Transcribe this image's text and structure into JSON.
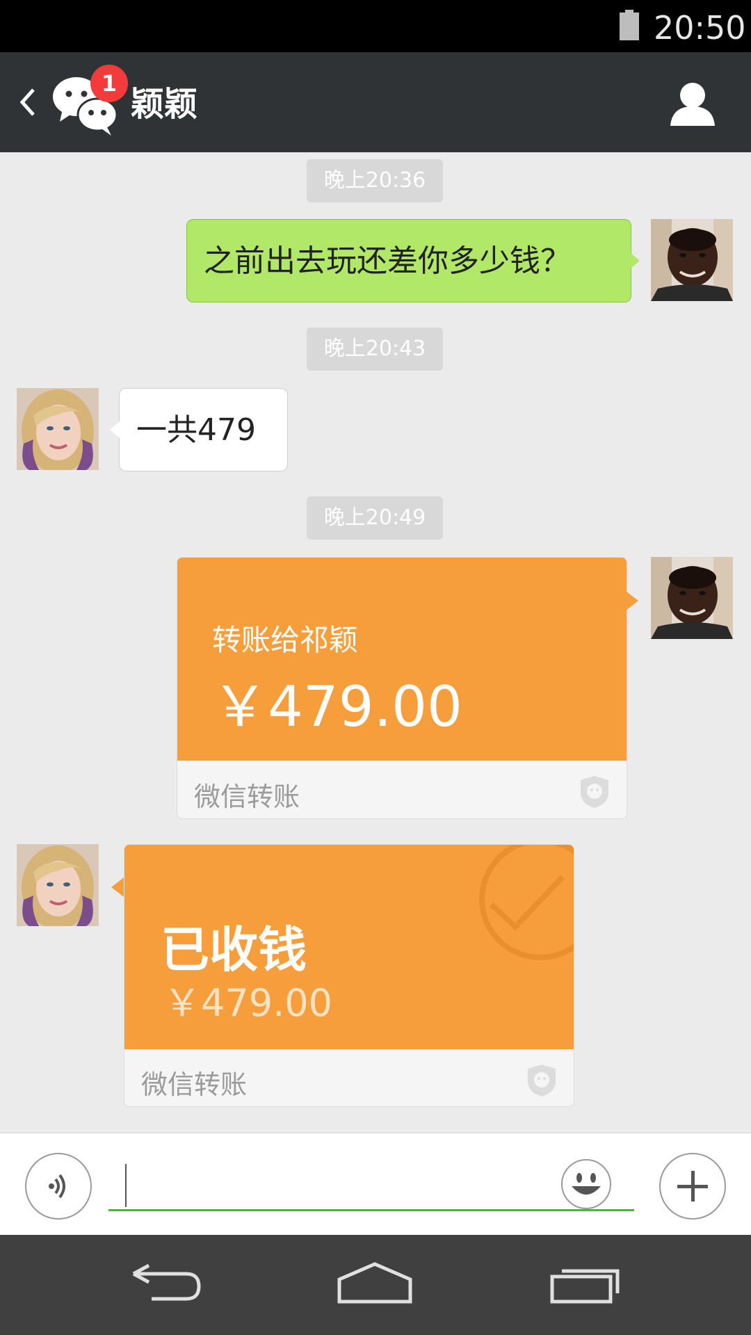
{
  "status_bar": {
    "time": "20:50",
    "battery_icon": "battery-icon"
  },
  "header": {
    "back_icon": "back-chevron-icon",
    "app_icon": "wechat-icon",
    "badge_count": "1",
    "title": "颖颖",
    "profile_icon": "profile-icon"
  },
  "messages": {
    "time1": "晚上20:36",
    "msg1": "之前出去玩还差你多少钱？",
    "time2": "晚上20:43",
    "msg2": "一共479",
    "time3": "晚上20:49",
    "transfer_sent": {
      "title": "转账给祁颖",
      "amount": "￥479.00",
      "footer": "微信转账"
    },
    "transfer_received": {
      "title": "已收钱",
      "amount": "￥479.00",
      "footer": "微信转账"
    }
  },
  "input_bar": {
    "voice_icon": "voice-icon",
    "emoji_icon": "emoji-icon",
    "plus_icon": "plus-icon",
    "input_value": ""
  },
  "nav_bar": {
    "back_icon": "nav-back-icon",
    "home_icon": "nav-home-icon",
    "recents_icon": "nav-recents-icon"
  },
  "colors": {
    "header_bg": "#2f3336",
    "sent_bubble": "#b2e867",
    "transfer_orange": "#f79e3c",
    "badge_red": "#f33b3b",
    "input_underline": "#45c01a"
  }
}
